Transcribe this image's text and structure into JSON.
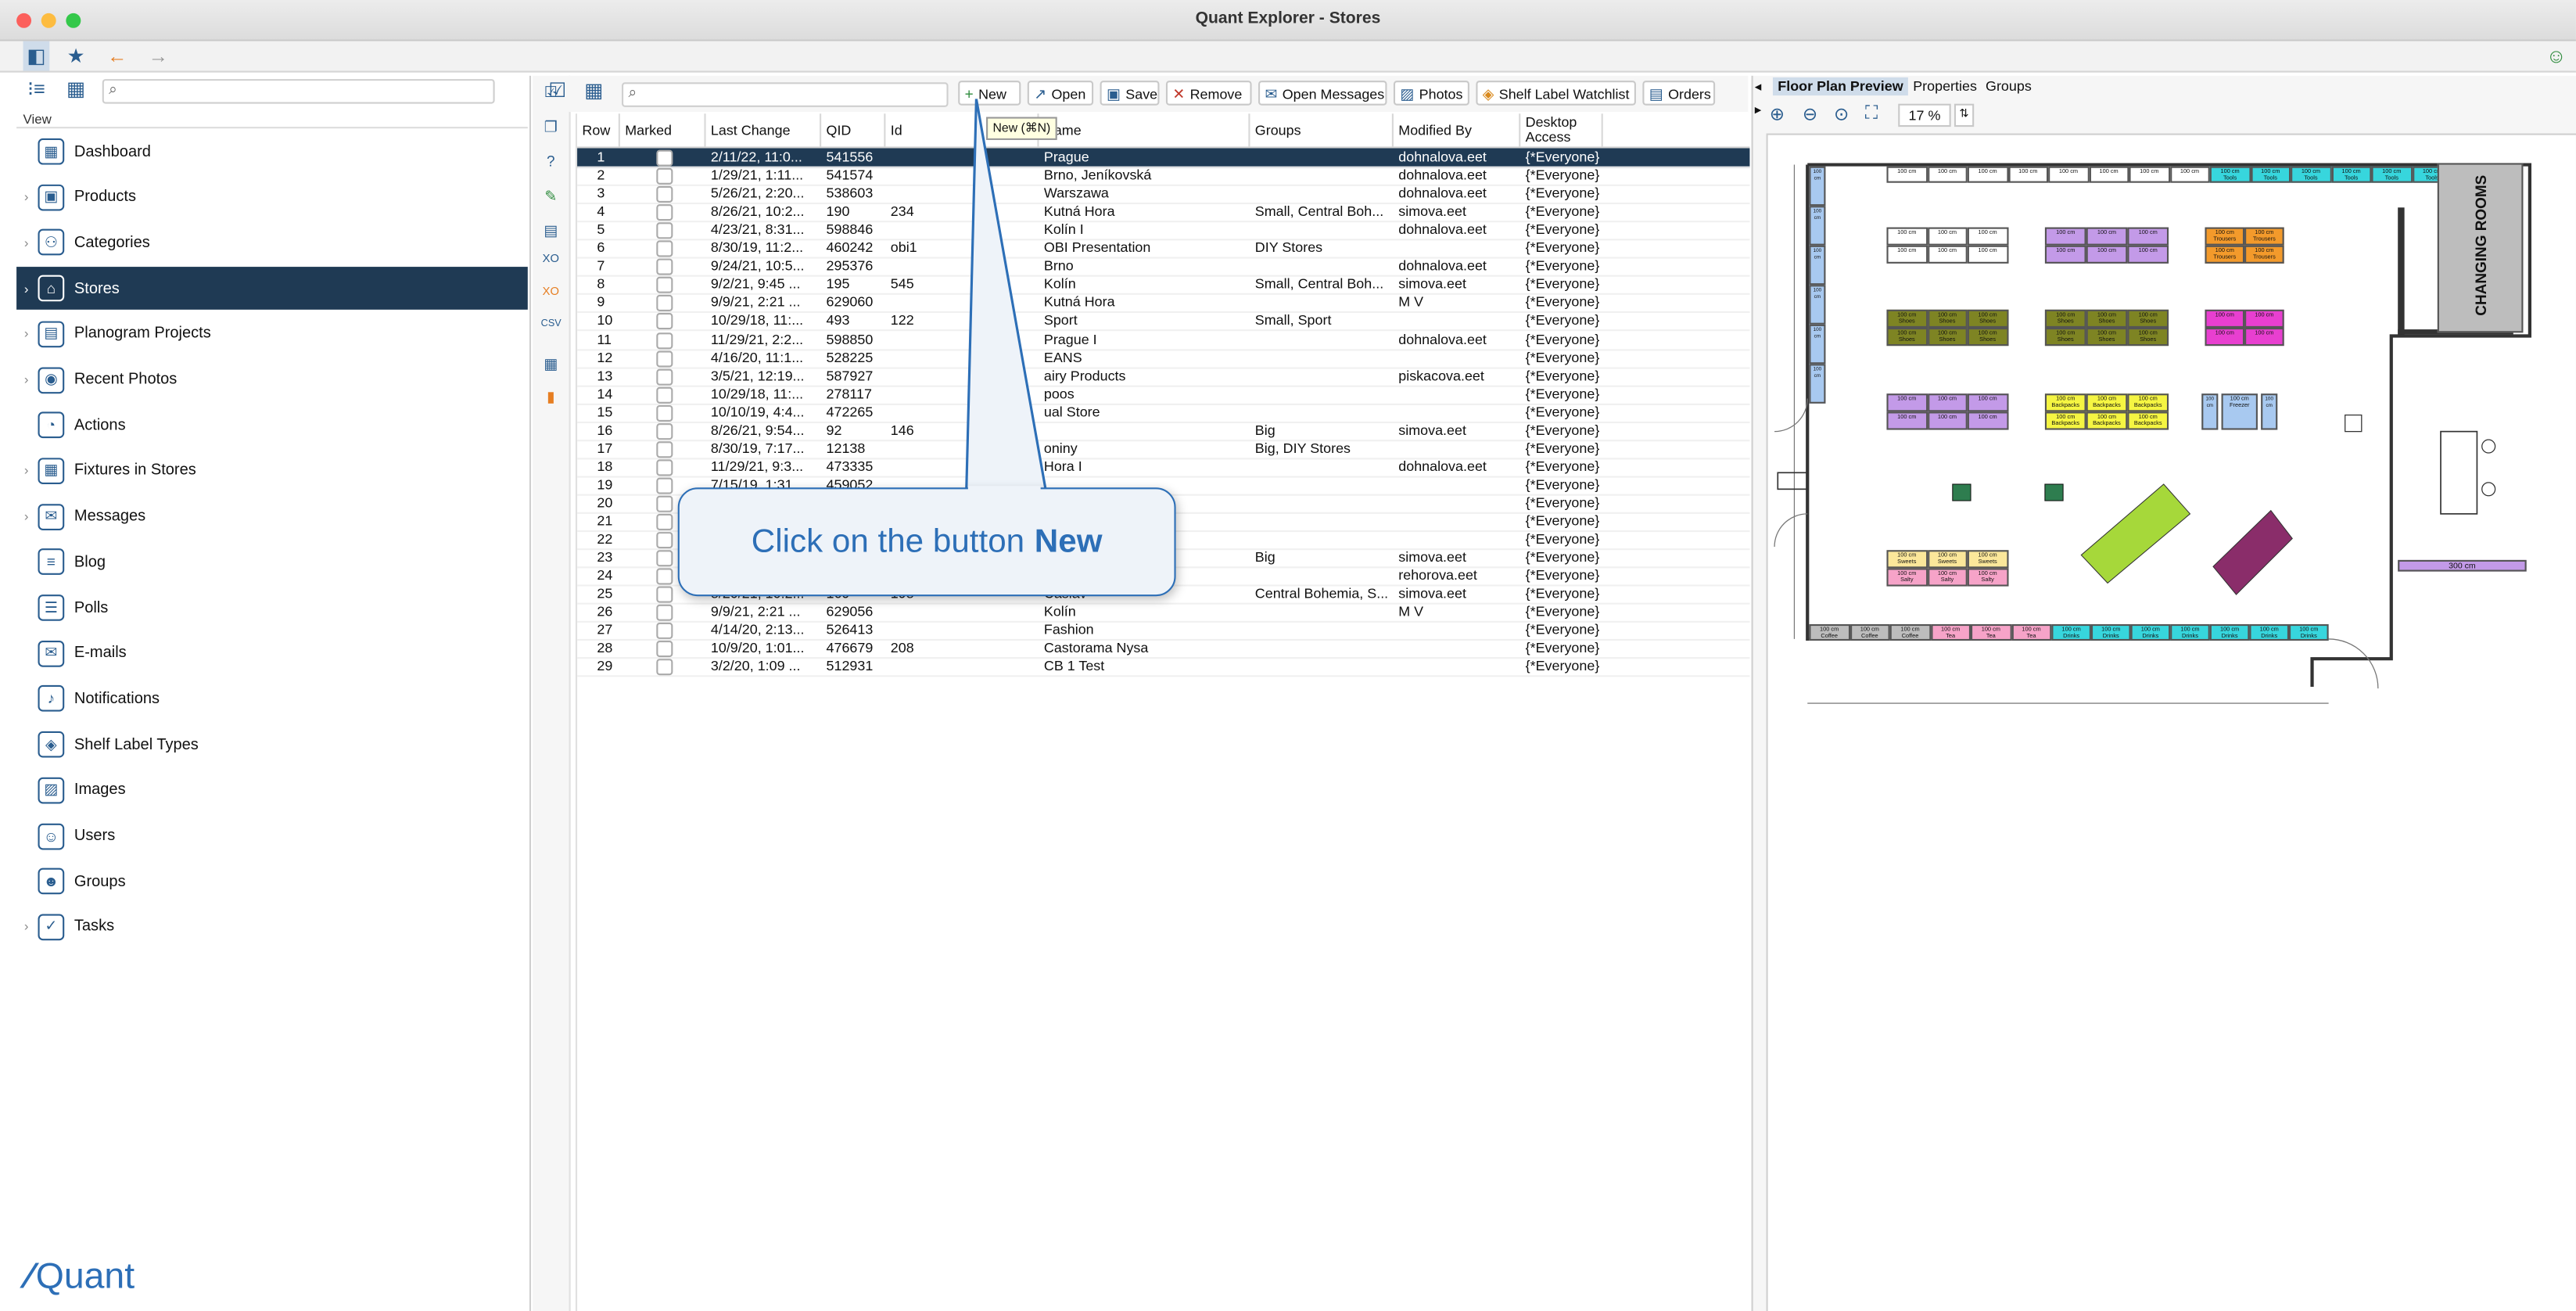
{
  "window": {
    "title": "Quant Explorer - Stores"
  },
  "left": {
    "view_label": "View",
    "items": [
      {
        "label": "Dashboard",
        "icon": "dashboard-icon",
        "glyph": "▦",
        "expand": false
      },
      {
        "label": "Products",
        "icon": "product-icon",
        "glyph": "▣",
        "expand": true
      },
      {
        "label": "Categories",
        "icon": "categories-icon",
        "glyph": "⚇",
        "expand": true
      },
      {
        "label": "Stores",
        "icon": "store-icon",
        "glyph": "⌂",
        "expand": true,
        "selected": true
      },
      {
        "label": "Planogram Projects",
        "icon": "planogram-icon",
        "glyph": "▤",
        "expand": true
      },
      {
        "label": "Recent Photos",
        "icon": "camera-icon",
        "glyph": "◉",
        "expand": true
      },
      {
        "label": "Actions",
        "icon": "actions-icon",
        "glyph": "◔",
        "expand": false
      },
      {
        "label": "Fixtures in Stores",
        "icon": "fixtures-icon",
        "glyph": "▦",
        "expand": true
      },
      {
        "label": "Messages",
        "icon": "messages-icon",
        "glyph": "✉",
        "expand": true
      },
      {
        "label": "Blog",
        "icon": "blog-icon",
        "glyph": "≡",
        "expand": false
      },
      {
        "label": "Polls",
        "icon": "polls-icon",
        "glyph": "☰",
        "expand": false
      },
      {
        "label": "E-mails",
        "icon": "email-icon",
        "glyph": "✉",
        "expand": false
      },
      {
        "label": "Notifications",
        "icon": "notification-icon",
        "glyph": "♪",
        "expand": false
      },
      {
        "label": "Shelf Label Types",
        "icon": "shelf-label-icon",
        "glyph": "◈",
        "expand": false
      },
      {
        "label": "Images",
        "icon": "images-icon",
        "glyph": "▨",
        "expand": false
      },
      {
        "label": "Users",
        "icon": "user-icon",
        "glyph": "☺",
        "expand": false
      },
      {
        "label": "Groups",
        "icon": "groups-icon",
        "glyph": "☻",
        "expand": false
      },
      {
        "label": "Tasks",
        "icon": "tasks-icon",
        "glyph": "✓",
        "expand": true
      }
    ],
    "logo_text": "Quant"
  },
  "toolbar": {
    "buttons": [
      {
        "label": "New",
        "icon": "plus-icon",
        "glyph": "+",
        "color": "#2e8b3d"
      },
      {
        "label": "Open",
        "icon": "open-icon",
        "glyph": "↗",
        "color": "#2a5d8f"
      },
      {
        "label": "Save",
        "icon": "save-icon",
        "glyph": "▣",
        "color": "#2a5d8f"
      },
      {
        "label": "Remove",
        "icon": "remove-icon",
        "glyph": "✕",
        "color": "#c0392b"
      },
      {
        "label": "Open Messages",
        "icon": "messages-icon",
        "glyph": "✉",
        "color": "#2a5d8f"
      },
      {
        "label": "Photos",
        "icon": "photos-icon",
        "glyph": "▨",
        "color": "#2a5d8f"
      },
      {
        "label": "Shelf Label Watchlist",
        "icon": "tag-icon",
        "glyph": "◈",
        "color": "#d98a1e"
      },
      {
        "label": "Orders",
        "icon": "orders-icon",
        "glyph": "▤",
        "color": "#2a5d8f"
      }
    ],
    "tooltip": "New (⌘N)"
  },
  "grid": {
    "columns": [
      "Row",
      "Marked",
      "Last Change",
      "QID",
      "Id",
      "Name",
      "Groups",
      "Modified By",
      "Desktop Access"
    ],
    "rows": [
      [
        "1",
        "",
        "2/11/22, 11:0...",
        "541556",
        "",
        "Prague",
        "",
        "dohnalova.eet",
        "{*Everyone}"
      ],
      [
        "2",
        "",
        "1/29/21, 1:11...",
        "541574",
        "",
        "Brno, Jeníkovská",
        "",
        "dohnalova.eet",
        "{*Everyone}"
      ],
      [
        "3",
        "",
        "5/26/21, 2:20...",
        "538603",
        "",
        "Warszawa",
        "",
        "dohnalova.eet",
        "{*Everyone}"
      ],
      [
        "4",
        "",
        "8/26/21, 10:2...",
        "190",
        "234",
        "Kutná Hora",
        "Small, Central Boh...",
        "simova.eet",
        "{*Everyone}"
      ],
      [
        "5",
        "",
        "4/23/21, 8:31...",
        "598846",
        "",
        "Kolín I",
        "",
        "dohnalova.eet",
        "{*Everyone}"
      ],
      [
        "6",
        "",
        "8/30/19, 11:2...",
        "460242",
        "obi1",
        "OBI Presentation",
        "DIY Stores",
        "",
        "{*Everyone}"
      ],
      [
        "7",
        "",
        "9/24/21, 10:5...",
        "295376",
        "",
        "Brno",
        "",
        "dohnalova.eet",
        "{*Everyone}"
      ],
      [
        "8",
        "",
        "9/2/21, 9:45 ...",
        "195",
        "545",
        "Kolín",
        "Small, Central Boh...",
        "simova.eet",
        "{*Everyone}"
      ],
      [
        "9",
        "",
        "9/9/21, 2:21 ...",
        "629060",
        "",
        "Kutná Hora",
        "",
        "M V",
        "{*Everyone}"
      ],
      [
        "10",
        "",
        "10/29/18, 11:...",
        "493",
        "122",
        "Sport",
        "Small, Sport",
        "",
        "{*Everyone}"
      ],
      [
        "11",
        "",
        "11/29/21, 2:2...",
        "598850",
        "",
        "Prague I",
        "",
        "dohnalova.eet",
        "{*Everyone}"
      ],
      [
        "12",
        "",
        "4/16/20, 11:1...",
        "528225",
        "",
        "EANS",
        "",
        "",
        "{*Everyone}"
      ],
      [
        "13",
        "",
        "3/5/21, 12:19...",
        "587927",
        "",
        "airy Products",
        "",
        "piskacova.eet",
        "{*Everyone}"
      ],
      [
        "14",
        "",
        "10/29/18, 11:...",
        "278117",
        "",
        "poos",
        "",
        "",
        "{*Everyone}"
      ],
      [
        "15",
        "",
        "10/10/19, 4:4...",
        "472265",
        "",
        "ual Store",
        "",
        "",
        "{*Everyone}"
      ],
      [
        "16",
        "",
        "8/26/21, 9:54...",
        "92",
        "146",
        "",
        "Big",
        "simova.eet",
        "{*Everyone}"
      ],
      [
        "17",
        "",
        "8/30/19, 7:17...",
        "12138",
        "",
        "oniny",
        "Big, DIY Stores",
        "",
        "{*Everyone}"
      ],
      [
        "18",
        "",
        "11/29/21, 9:3...",
        "473335",
        "",
        "Hora I",
        "",
        "dohnalova.eet",
        "{*Everyone}"
      ],
      [
        "19",
        "",
        "7/15/19, 1:31...",
        "459052",
        "",
        "",
        "",
        "",
        "{*Everyone}"
      ],
      [
        "20",
        "",
        "",
        "",
        "",
        "",
        "",
        "",
        "{*Everyone}"
      ],
      [
        "21",
        "",
        "",
        "",
        "",
        "",
        "",
        "",
        "{*Everyone}"
      ],
      [
        "22",
        "",
        "",
        "",
        "",
        "",
        "",
        "",
        "{*Everyone}"
      ],
      [
        "23",
        "",
        "",
        "",
        "",
        "",
        "Big",
        "simova.eet",
        "{*Everyone}"
      ],
      [
        "24",
        "",
        "",
        "",
        "",
        "",
        "",
        "rehorova.eet",
        "{*Everyone}"
      ],
      [
        "25",
        "",
        "8/20/21, 10:2...",
        "169",
        "198",
        "Čáslav",
        "Central Bohemia, S...",
        "simova.eet",
        "{*Everyone}"
      ],
      [
        "26",
        "",
        "9/9/21, 2:21 ...",
        "629056",
        "",
        "Kolín",
        "",
        "M V",
        "{*Everyone}"
      ],
      [
        "27",
        "",
        "4/14/20, 2:13...",
        "526413",
        "",
        "Fashion",
        "",
        "",
        "{*Everyone}"
      ],
      [
        "28",
        "",
        "10/9/20, 1:01...",
        "476679",
        "208",
        "Castorama Nysa",
        "",
        "",
        "{*Everyone}"
      ],
      [
        "29",
        "",
        "3/2/20, 1:09 ...",
        "512931",
        "",
        "CB 1 Test",
        "",
        "",
        "{*Everyone}"
      ]
    ]
  },
  "callout": {
    "text": "Click on the button",
    "bold": "New"
  },
  "right": {
    "tabs": [
      "Floor Plan Preview",
      "Properties",
      "Groups"
    ],
    "zoom": "17 %",
    "changing_rooms": "CHANGING ROOMS",
    "sizes": {
      "s100": "100 cm",
      "s300": "300 cm"
    },
    "fixtures": {
      "tools": "Tools",
      "trousers": "Trousers",
      "shoes": "Shoes",
      "backpacks": "Backpacks",
      "sweets": "Sweets",
      "salty": "Salty",
      "coffee": "Coffee",
      "tea": "Tea",
      "drinks": "Drinks",
      "freezer": "Freezer"
    }
  },
  "colors": {
    "selection": "#1f3a54",
    "accent": "#2d6fb7",
    "cyan": "#37d6dd",
    "orange": "#f39a2b",
    "olive": "#7e8423",
    "purple": "#c39ae8",
    "yellow": "#f5f542",
    "magenta": "#e83fd0",
    "lightblue": "#a8c9f0",
    "lime": "#a6d83a",
    "maroon": "#8a2d6a",
    "pink": "#f6a3c8",
    "gray": "#bdbdbd",
    "cream": "#fbe79a"
  }
}
